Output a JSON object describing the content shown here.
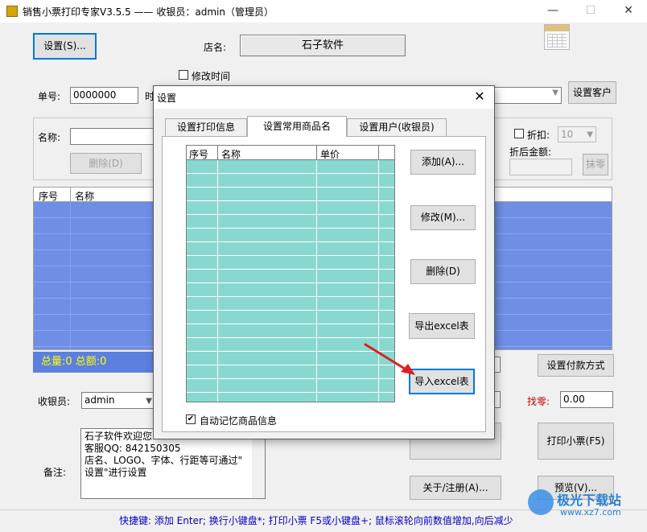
{
  "window": {
    "title": "销售小票打印专家V3.5.5 —— 收银员：admin（管理员）",
    "minimize": "—",
    "maximize": "☐",
    "close": "✕"
  },
  "toolbar": {
    "settings_btn": "设置(S)...",
    "shop_label": "店名:",
    "shop_name": "石子软件",
    "edit_time_label": "修改时间",
    "order_label": "单号:",
    "order_value": "0000000",
    "time_label_partial": "时",
    "set_customer_btn": "设置客户"
  },
  "item_panel": {
    "name_label": "名称:",
    "delete_btn": "删除(D)",
    "discount_label": "折扣:",
    "discount_value": "10",
    "after_discount_label": "折后金额:",
    "round_btn": "抹零"
  },
  "main_table": {
    "columns": [
      "序号",
      "名称"
    ],
    "row_count": 10
  },
  "totals": {
    "text": "总量:0   总额:0"
  },
  "payment": {
    "set_payment_btn": "设置付款方式",
    "change_label": "找零:",
    "change_value": "0.00"
  },
  "cashier": {
    "label": "收银员:",
    "value": "admin"
  },
  "memo": {
    "label": "备注:",
    "lines": [
      "石子软件欢迎您",
      "客服QQ: 842150305",
      "店名、LOGO、字体、行距等可通过\"",
      "设置\"进行设置"
    ]
  },
  "actions": {
    "print_btn": "打印小票(F5)",
    "about_btn": "关于/注册(A)...",
    "preview_btn": "预览(V)..."
  },
  "hint": "快捷键: 添加 Enter; 换行小键盘*; 打印小票 F5或小键盘+; 鼠标滚轮向前数值增加,向后减少",
  "watermark": {
    "brand": "极光下载站",
    "url": "www.xz7.com"
  },
  "dialog": {
    "title": "设置",
    "close": "✕",
    "tabs": [
      "设置打印信息",
      "设置常用商品名",
      "设置用户(收银员)"
    ],
    "active_tab": 1,
    "table_columns": [
      "序号",
      "名称",
      "单价"
    ],
    "table_rows": 17,
    "buttons": {
      "add": "添加(A)...",
      "edit": "修改(M)...",
      "delete": "删除(D)",
      "export": "导出excel表",
      "import": "导入excel表"
    },
    "remember_label": "自动记忆商品信息",
    "remember_checked": true
  },
  "colors": {
    "main_table_bg": "#6f8fe6",
    "goods_table_bg": "#88d8d0",
    "total_text": "#ffff00",
    "hint_text": "#0000c8",
    "arrow": "#e02020"
  }
}
